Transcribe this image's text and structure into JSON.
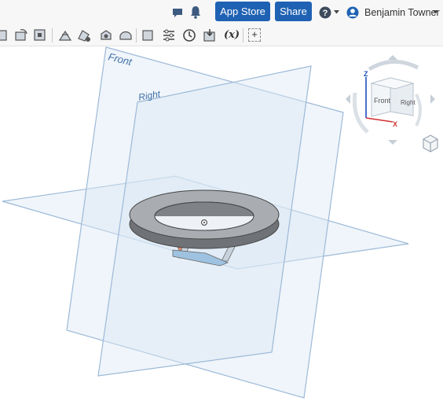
{
  "header": {
    "app_store_label": "App Store",
    "share_label": "Share",
    "user_name": "Benjamin Towner",
    "icons": [
      "chat-icon",
      "bell-icon",
      "help-icon",
      "user-icon",
      "dropdown-icon"
    ]
  },
  "toolbar": {
    "icons": [
      "extrude-icon",
      "revolve-icon",
      "sweep-icon",
      "fillet-icon",
      "chamfer-icon",
      "shell-icon",
      "draft-icon",
      "plane-icon",
      "mate-connector-icon",
      "history-icon",
      "import-icon",
      "variable-icon",
      "add-icon"
    ],
    "variable_label": "(x)",
    "add_label": "+"
  },
  "viewport": {
    "planes": {
      "front_label": "Front",
      "right_label": "Right"
    },
    "view_cube": {
      "front_label": "Front",
      "right_label": "Right",
      "axis_z": "Z",
      "axis_x": "X"
    }
  },
  "colors": {
    "accent": "#1f62b3",
    "plane_fill": "#dce8f4",
    "plane_edge": "#9db9d8",
    "axis_z": "#1f4fbf",
    "axis_x": "#d03030"
  }
}
